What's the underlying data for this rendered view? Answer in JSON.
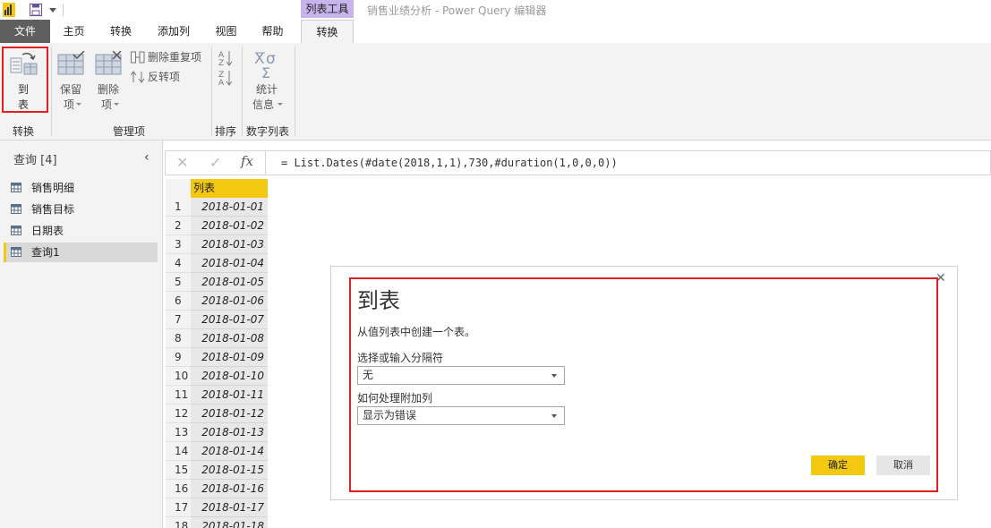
{
  "window": {
    "title": "销售业绩分析 - Power Query 编辑器",
    "context_tab": "列表工具",
    "quick_access_icons": [
      "powerbi-logo-icon",
      "save-icon",
      "dropdown-icon"
    ]
  },
  "tabs": [
    {
      "label": "文件"
    },
    {
      "label": "主页"
    },
    {
      "label": "转换"
    },
    {
      "label": "添加列"
    },
    {
      "label": "视图"
    },
    {
      "label": "帮助"
    },
    {
      "label": "转换",
      "active": true
    }
  ],
  "ribbon": {
    "to_table_line1": "到",
    "to_table_line2": "表",
    "keep_items_line1": "保留",
    "keep_items_line2": "项",
    "remove_items_line1": "删除",
    "remove_items_line2": "项",
    "remove_duplicates": "删除重复项",
    "reverse_items": "反转项",
    "statistics_line1": "统计",
    "statistics_line2": "信息",
    "group_convert": "转换",
    "group_manage": "管理项",
    "group_sort": "排序",
    "group_numeric": "数字列表"
  },
  "queries": {
    "header": "查询 [4]",
    "items": [
      {
        "label": "销售明细"
      },
      {
        "label": "销售目标"
      },
      {
        "label": "日期表"
      },
      {
        "label": "查询1",
        "selected": true
      }
    ]
  },
  "formula": {
    "fx": "fx",
    "text": "= List.Dates(#date(2018,1,1),730,#duration(1,0,0,0))"
  },
  "table": {
    "column": "列表",
    "rows": [
      {
        "n": "1",
        "v": "2018-01-01"
      },
      {
        "n": "2",
        "v": "2018-01-02"
      },
      {
        "n": "3",
        "v": "2018-01-03"
      },
      {
        "n": "4",
        "v": "2018-01-04"
      },
      {
        "n": "5",
        "v": "2018-01-05"
      },
      {
        "n": "6",
        "v": "2018-01-06"
      },
      {
        "n": "7",
        "v": "2018-01-07"
      },
      {
        "n": "8",
        "v": "2018-01-08"
      },
      {
        "n": "9",
        "v": "2018-01-09"
      },
      {
        "n": "10",
        "v": "2018-01-10"
      },
      {
        "n": "11",
        "v": "2018-01-11"
      },
      {
        "n": "12",
        "v": "2018-01-12"
      },
      {
        "n": "13",
        "v": "2018-01-13"
      },
      {
        "n": "14",
        "v": "2018-01-14"
      },
      {
        "n": "15",
        "v": "2018-01-15"
      },
      {
        "n": "16",
        "v": "2018-01-16"
      },
      {
        "n": "17",
        "v": "2018-01-17"
      },
      {
        "n": "18",
        "v": "2018-01-18"
      }
    ]
  },
  "dialog": {
    "title": "到表",
    "description": "从值列表中创建一个表。",
    "delimiter_label": "选择或输入分隔符",
    "delimiter_value": "无",
    "extra_columns_label": "如何处理附加列",
    "extra_columns_value": "显示为错误",
    "ok": "确定",
    "cancel": "取消"
  },
  "colors": {
    "accent": "#f2c811",
    "highlight": "#e02020",
    "context_tab": "#c7b4ec"
  }
}
